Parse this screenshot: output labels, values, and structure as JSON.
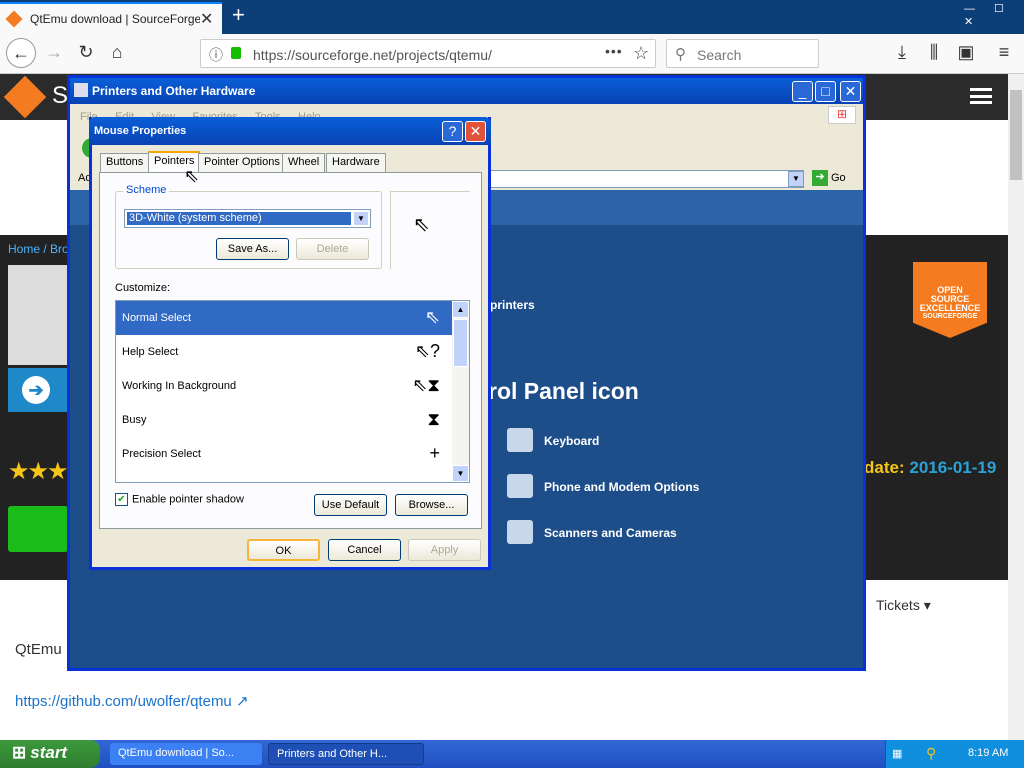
{
  "browser": {
    "tab_title": "QtEmu download | SourceForge.net",
    "url": "https://sourceforge.net/projects/qtemu/",
    "search_placeholder": "Search",
    "new_tab": "+",
    "window_controls": "— ☐ ✕"
  },
  "page": {
    "logo_letter": "S",
    "breadcrumb": "Home / Bro",
    "badge_text": "OPEN SOURCE EXCELLENCE",
    "badge_brand": "SOURCEFORGE",
    "update_label": "date:",
    "update_value": "2016-01-19",
    "tickets": "Tickets ▾",
    "project_name": "QtEmu",
    "github_link": "https://github.com/uwolfer/qtemu"
  },
  "control_panel": {
    "title": "Printers and Other Hardware",
    "menu": [
      "File",
      "Edit",
      "View",
      "Favorites",
      "Tools",
      "Help"
    ],
    "address_label": "Ad",
    "go_label": "Go",
    "printers_text": "printers",
    "heading": "rol Panel icon",
    "items": [
      "Keyboard",
      "Phone and Modem Options",
      "Scanners and Cameras"
    ]
  },
  "mouse_properties": {
    "title": "Mouse Properties",
    "tabs": [
      "Buttons",
      "Pointers",
      "Pointer Options",
      "Wheel",
      "Hardware"
    ],
    "selected_tab": "Pointers",
    "scheme_label": "Scheme",
    "scheme_value": "3D-White (system scheme)",
    "save_as": "Save As...",
    "delete": "Delete",
    "customize_label": "Customize:",
    "pointers": [
      {
        "name": "Normal Select",
        "icon": "⇖"
      },
      {
        "name": "Help Select",
        "icon": "⇖?"
      },
      {
        "name": "Working In Background",
        "icon": "⇖⧗"
      },
      {
        "name": "Busy",
        "icon": "⧗"
      },
      {
        "name": "Precision Select",
        "icon": "+"
      }
    ],
    "shadow_label": "Enable pointer shadow",
    "use_default": "Use Default",
    "browse": "Browse...",
    "ok": "OK",
    "cancel": "Cancel",
    "apply": "Apply"
  },
  "taskbar": {
    "start": "start",
    "tasks": [
      "QtEmu download | So...",
      "Printers and Other H..."
    ],
    "clock": "8:19 AM"
  }
}
